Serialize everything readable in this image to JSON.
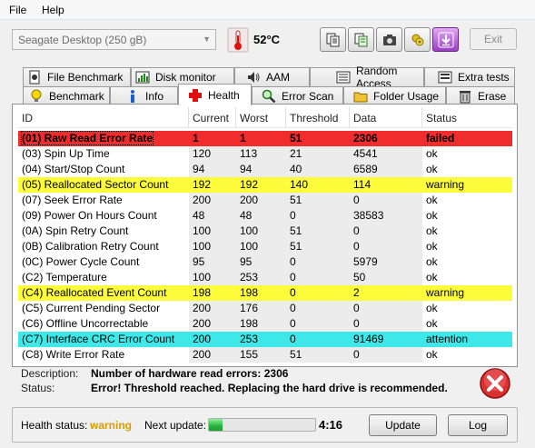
{
  "menu": {
    "file": "File",
    "help": "Help"
  },
  "toolbar": {
    "drive": "Seagate Desktop (250 gB)",
    "temperature": "52°C",
    "exit_label": "Exit",
    "icons": [
      "copy-icon",
      "copy-alt-icon",
      "camera-icon",
      "tools-icon",
      "save-down-icon"
    ]
  },
  "tabs": {
    "top": [
      "File Benchmark",
      "Disk monitor",
      "AAM",
      "Random Access",
      "Extra tests"
    ],
    "bottom": [
      "Benchmark",
      "Info",
      "Health",
      "Error Scan",
      "Folder Usage",
      "Erase"
    ],
    "active": "Health"
  },
  "table": {
    "headers": [
      "ID",
      "Current",
      "Worst",
      "Threshold",
      "Data",
      "Status"
    ],
    "rows": [
      {
        "id": "(01) Raw Read Error Rate",
        "current": "1",
        "worst": "1",
        "threshold": "51",
        "data": "2306",
        "status": "failed",
        "state": "failed"
      },
      {
        "id": "(03) Spin Up Time",
        "current": "120",
        "worst": "113",
        "threshold": "21",
        "data": "4541",
        "status": "ok",
        "state": "ok"
      },
      {
        "id": "(04) Start/Stop Count",
        "current": "94",
        "worst": "94",
        "threshold": "40",
        "data": "6589",
        "status": "ok",
        "state": "ok"
      },
      {
        "id": "(05) Reallocated Sector Count",
        "current": "192",
        "worst": "192",
        "threshold": "140",
        "data": "114",
        "status": "warning",
        "state": "warning"
      },
      {
        "id": "(07) Seek Error Rate",
        "current": "200",
        "worst": "200",
        "threshold": "51",
        "data": "0",
        "status": "ok",
        "state": "ok"
      },
      {
        "id": "(09) Power On Hours Count",
        "current": "48",
        "worst": "48",
        "threshold": "0",
        "data": "38583",
        "status": "ok",
        "state": "ok"
      },
      {
        "id": "(0A) Spin Retry Count",
        "current": "100",
        "worst": "100",
        "threshold": "51",
        "data": "0",
        "status": "ok",
        "state": "ok"
      },
      {
        "id": "(0B) Calibration Retry Count",
        "current": "100",
        "worst": "100",
        "threshold": "51",
        "data": "0",
        "status": "ok",
        "state": "ok"
      },
      {
        "id": "(0C) Power Cycle Count",
        "current": "95",
        "worst": "95",
        "threshold": "0",
        "data": "5979",
        "status": "ok",
        "state": "ok"
      },
      {
        "id": "(C2) Temperature",
        "current": "100",
        "worst": "253",
        "threshold": "0",
        "data": "50",
        "status": "ok",
        "state": "ok"
      },
      {
        "id": "(C4) Reallocated Event Count",
        "current": "198",
        "worst": "198",
        "threshold": "0",
        "data": "2",
        "status": "warning",
        "state": "warning"
      },
      {
        "id": "(C5) Current Pending Sector",
        "current": "200",
        "worst": "176",
        "threshold": "0",
        "data": "0",
        "status": "ok",
        "state": "ok"
      },
      {
        "id": "(C6) Offline Uncorrectable",
        "current": "200",
        "worst": "198",
        "threshold": "0",
        "data": "0",
        "status": "ok",
        "state": "ok"
      },
      {
        "id": "(C7) Interface CRC Error Count",
        "current": "200",
        "worst": "253",
        "threshold": "0",
        "data": "91469",
        "status": "attention",
        "state": "attention"
      },
      {
        "id": "(C8) Write Error Rate",
        "current": "200",
        "worst": "155",
        "threshold": "51",
        "data": "0",
        "status": "ok",
        "state": "ok"
      }
    ]
  },
  "details": {
    "description_label": "Description:",
    "description": "Number of hardware read errors: 2306",
    "status_label": "Status:",
    "status": "Error! Threshold reached. Replacing the hard drive is recommended."
  },
  "footer": {
    "health_label": "Health status:",
    "health_value": "warning",
    "next_update_label": "Next update:",
    "countdown": "4:16",
    "progress_fraction": 0.13,
    "update_label": "Update",
    "log_label": "Log"
  },
  "colors": {
    "failed": "#f02c2c",
    "warning": "#fcfc3a",
    "attention": "#3ee8e8",
    "health_warning_text": "#d89c00"
  }
}
